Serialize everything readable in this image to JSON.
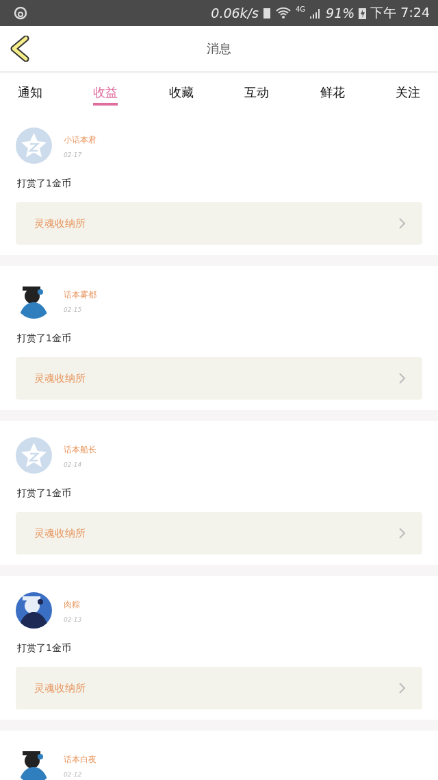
{
  "status_bar": {
    "speed": "0.06k/s",
    "network": "4G",
    "battery": "91%",
    "time": "下午 7:24"
  },
  "header": {
    "title": "消息"
  },
  "tabs": [
    {
      "label": "通知",
      "selected": false
    },
    {
      "label": "收益",
      "selected": true
    },
    {
      "label": "收藏",
      "selected": false
    },
    {
      "label": "互动",
      "selected": false
    },
    {
      "label": "鲜花",
      "selected": false
    },
    {
      "label": "关注",
      "selected": false
    }
  ],
  "messages": [
    {
      "kind": "default",
      "name": "小话本君",
      "date": "02-17",
      "text": "打赏了1金币",
      "link": "灵魂收纳所"
    },
    {
      "kind": "picture",
      "name": "话本雾都",
      "date": "02-15",
      "text": "打赏了1金币",
      "link": "灵魂收纳所"
    },
    {
      "kind": "default",
      "name": "话本船长",
      "date": "02-14",
      "text": "打赏了1金币",
      "link": "灵魂收纳所"
    },
    {
      "kind": "picture",
      "name": "肉粽",
      "date": "02-13",
      "text": "打赏了1金币",
      "link": "灵魂收纳所"
    },
    {
      "kind": "picture",
      "name": "话本白夜",
      "date": "02-12"
    }
  ]
}
